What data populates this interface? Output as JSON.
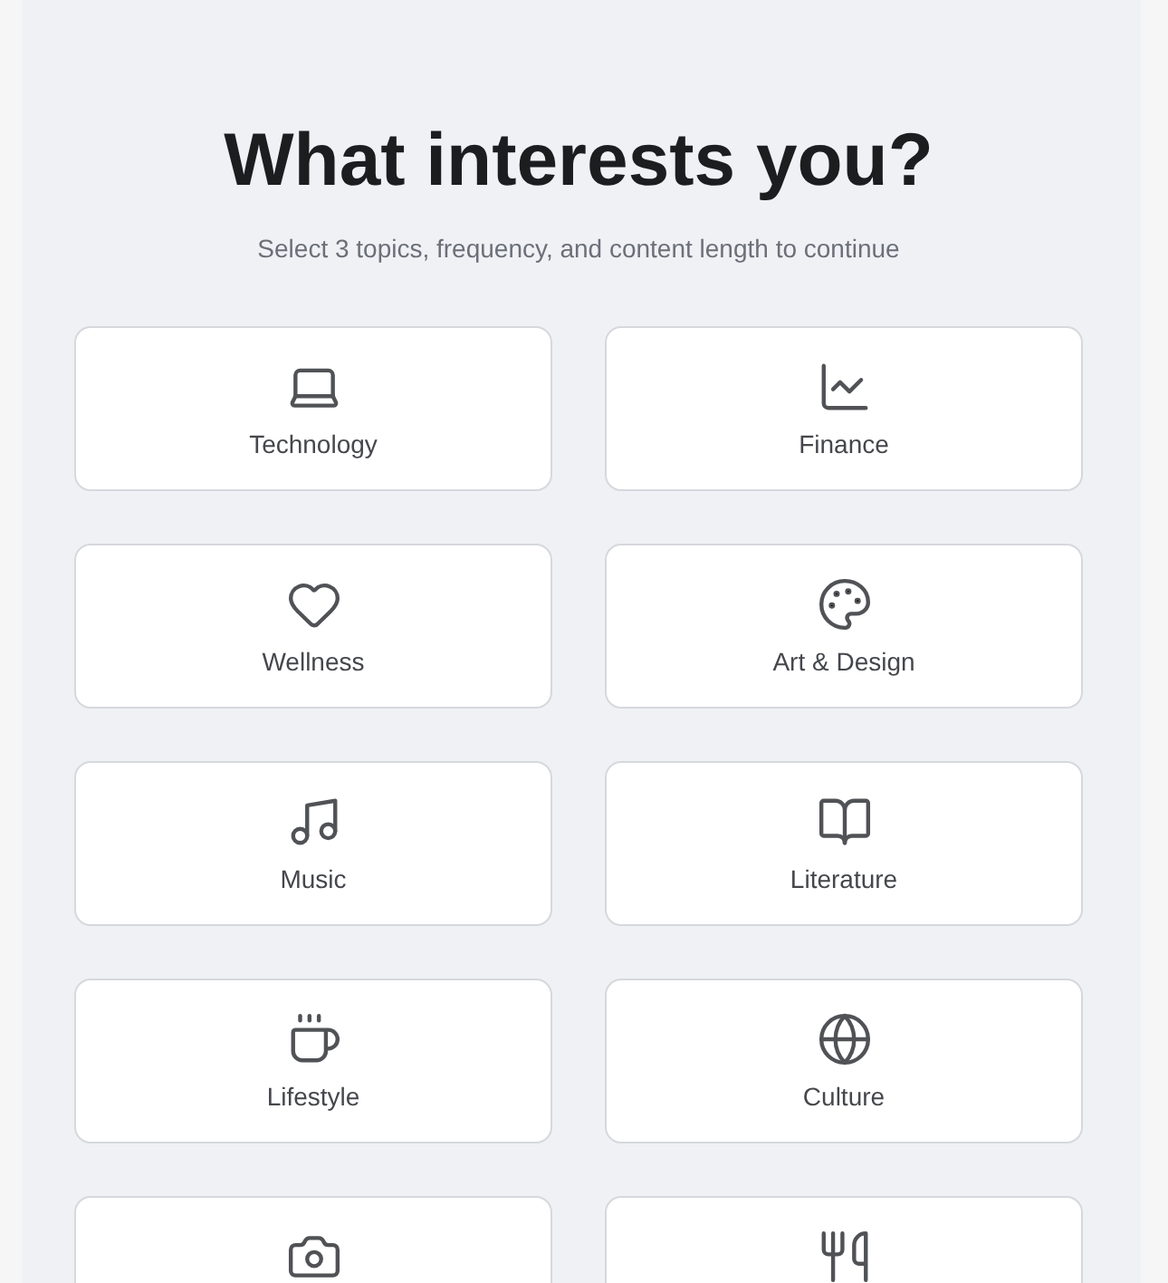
{
  "heading": {
    "title": "What interests you?",
    "subtitle": "Select 3 topics, frequency, and content length to continue"
  },
  "topics": [
    {
      "kind": "labeled",
      "label": "Technology"
    },
    {
      "kind": "labeled",
      "label": "Finance"
    },
    {
      "kind": "labeled",
      "label": "Wellness"
    },
    {
      "kind": "labeled",
      "label": "Art & Design"
    },
    {
      "kind": "labeled",
      "label": "Music"
    },
    {
      "kind": "labeled",
      "label": "Literature"
    },
    {
      "kind": "labeled",
      "label": "Lifestyle"
    },
    {
      "kind": "labeled",
      "label": "Culture"
    },
    {
      "kind": "icon_only"
    },
    {
      "kind": "icon_only"
    }
  ]
}
